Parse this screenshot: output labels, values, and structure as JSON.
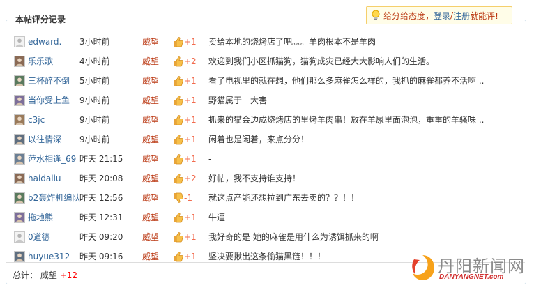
{
  "panel": {
    "title": "本帖评分记录",
    "rate_prompt": "给分给态度，",
    "login": "登录",
    "separator": "/",
    "register": "注册",
    "qualify": "就能评!"
  },
  "records": [
    {
      "user": "edward.",
      "avatar": "default-avatar",
      "time": "3小时前",
      "field": "威望",
      "score": "+1",
      "vote": "up",
      "reason": "卖给本地的烧烤店了吧。。。羊肉根本不是羊肉"
    },
    {
      "user": "乐乐歌",
      "avatar": "user-photo-avatar",
      "time": "4小时前",
      "field": "威望",
      "score": "+2",
      "vote": "up",
      "reason": "欢迎到我们小区抓猫狗，猫狗成灾已经大大影响人们的生活。"
    },
    {
      "user": "三杯醉不倒",
      "avatar": "user-photo-avatar",
      "time": "5小时前",
      "field": "威望",
      "score": "+1",
      "vote": "up",
      "reason": "看了电视里的就在想，他们那么多麻雀怎么样的，我抓的麻雀都养不活啊 .."
    },
    {
      "user": "当你受上鱼",
      "avatar": "user-photo-avatar",
      "time": "9小时前",
      "field": "威望",
      "score": "+1",
      "vote": "up",
      "reason": "野猫属于一大害"
    },
    {
      "user": "c3jc",
      "avatar": "user-photo-avatar",
      "time": "9小时前",
      "field": "威望",
      "score": "+1",
      "vote": "up",
      "reason": "抓来的猫会边成烧烤店的里烤羊肉串！放在羊尿里面泡泡，重重的羊骚味 .."
    },
    {
      "user": "以往情深",
      "avatar": "user-photo-avatar",
      "time": "9小时前",
      "field": "威望",
      "score": "+1",
      "vote": "up",
      "reason": "闲着也是闲着，来点分分！"
    },
    {
      "user": "萍水相逢_69",
      "avatar": "user-photo-avatar",
      "time": "昨天 21:15",
      "field": "威望",
      "score": "+1",
      "vote": "up",
      "reason": "-"
    },
    {
      "user": "haidaliu",
      "avatar": "user-photo-avatar",
      "time": "昨天 20:08",
      "field": "威望",
      "score": "+2",
      "vote": "up",
      "reason": "好帖，我不支持谁支持！"
    },
    {
      "user": "b2轰炸机编队",
      "avatar": "user-photo-avatar",
      "time": "昨天 12:56",
      "field": "威望",
      "score": "-1",
      "vote": "down",
      "reason": "就这点产能还想拉到广东去卖的？？！！"
    },
    {
      "user": "拖地熊",
      "avatar": "user-photo-avatar",
      "time": "昨天 12:31",
      "field": "威望",
      "score": "+1",
      "vote": "up",
      "reason": "牛逼"
    },
    {
      "user": "0道德",
      "avatar": "default-avatar",
      "time": "昨天 09:20",
      "field": "威望",
      "score": "+1",
      "vote": "up",
      "reason": "我好奇的是 她的麻雀是用什么为诱饵抓来的啊"
    },
    {
      "user": "huyue312",
      "avatar": "user-photo-avatar",
      "time": "昨天 09:16",
      "field": "威望",
      "score": "+1",
      "vote": "up",
      "reason": "坚决要揪出这条偷猫黑链！！！"
    }
  ],
  "total": {
    "label": "总计：",
    "field": "威望",
    "score": "+12"
  },
  "watermark": {
    "cn": "丹阳新闻网",
    "en": "DANYANGNET.com"
  },
  "colors": {
    "border": "#c2d5e3",
    "link": "#336699",
    "field": "#ba350f",
    "score": "#f26c4f",
    "total_score": "#ff0000"
  }
}
